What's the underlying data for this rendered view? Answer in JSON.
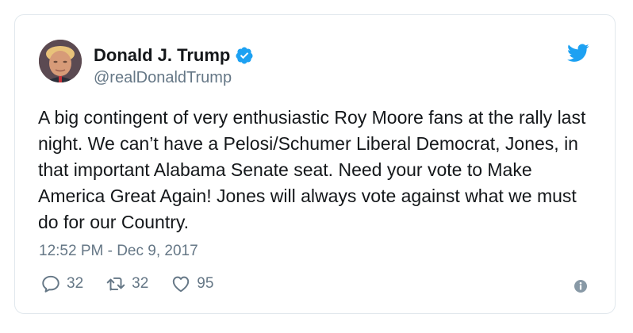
{
  "tweet": {
    "display_name": "Donald J. Trump",
    "handle": "@realDonaldTrump",
    "text": "A big contingent of very enthusiastic Roy Moore fans at the rally last night. We can’t have a Pelosi/Schumer Liberal Democrat, Jones, in that important Alabama Senate seat. Need your vote to Make America Great Again! Jones will always vote against what we must do for our Country.",
    "timestamp": "12:52 PM - Dec 9, 2017",
    "verified": true
  },
  "actions": {
    "reply_count": "32",
    "retweet_count": "32",
    "like_count": "95"
  },
  "icons": {
    "brand": "twitter-bird-icon",
    "verified": "verified-badge-icon",
    "reply": "reply-icon",
    "retweet": "retweet-icon",
    "like": "heart-icon",
    "info": "info-icon"
  },
  "colors": {
    "twitter_blue": "#1da1f2",
    "text": "#14171a",
    "secondary": "#657786",
    "border": "#e1e8ed"
  }
}
